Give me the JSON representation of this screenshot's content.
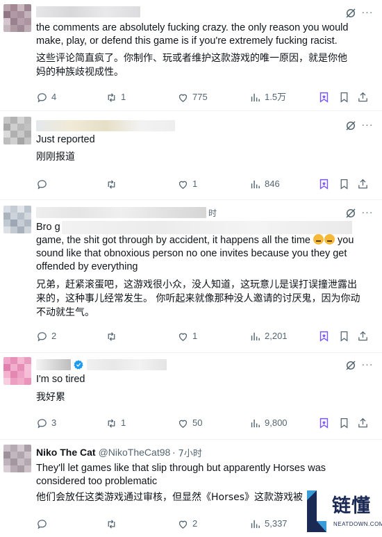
{
  "posts": [
    {
      "name": "",
      "handle": "",
      "time": "",
      "verified": false,
      "text_en": "the comments are absolutely fucking crazy. the only reason you would make, play, or defend this game is if you're extremely fucking racist.",
      "text_zh": "这些评论简直疯了。你制作、玩或者维护这款游戏的唯一原因，就是你他妈的种族歧视成性。",
      "replies": "4",
      "reposts": "1",
      "likes": "775",
      "views": "1.5万"
    },
    {
      "name": "",
      "handle": "",
      "time": "",
      "verified": false,
      "text_en": "Just reported",
      "text_zh": "刚刚报道",
      "replies": "",
      "reposts": "",
      "likes": "1",
      "views": "846"
    },
    {
      "name": "",
      "handle": "",
      "time": "时",
      "verified": false,
      "text_en_line1": "Bro g",
      "text_en_rest": "game, the shit got through by accident, it happens all the time",
      "text_en_tail": "you sound like that obnoxious person no one invites because you they get offended by everything",
      "text_zh": "兄弟，赶紧滚蛋吧，这游戏很小众，没人知道，这玩意儿是误打误撞泄露出来的，这种事儿经常发生。 你听起来就像那种没人邀请的讨厌鬼，因为你动不动就生气。",
      "replies": "2",
      "reposts": "",
      "likes": "1",
      "views": "2,201"
    },
    {
      "name": "",
      "handle": "",
      "time": "",
      "verified": true,
      "text_en": "I'm so tired",
      "text_zh": "我好累",
      "replies": "3",
      "reposts": "1",
      "likes": "50",
      "views": "9,800"
    },
    {
      "name": "Niko The Cat",
      "handle": "@NikoTheCat98",
      "time": "· 7小时",
      "verified": false,
      "text_en": "They'll let games like that slip through but apparently Horses was considered too problematic",
      "text_zh": "他们会放任这类游戏通过审核，但显然《Horses》这款游戏被",
      "replies": "",
      "reposts": "",
      "likes": "2",
      "views": "5,337"
    }
  ],
  "watermark": {
    "text": "链懂",
    "sub": "NEATDOWN.COM"
  },
  "colors": {
    "icon_gray": "#536471",
    "bookmark_purple": "#7856ff",
    "verified_blue": "#1d9bf0",
    "divider": "#eff3f4"
  },
  "icons": [
    "reply-icon",
    "repost-icon",
    "like-icon",
    "views-icon",
    "grok-icon",
    "bookmark-icon",
    "share-icon",
    "more-icon",
    "verified-icon"
  ]
}
